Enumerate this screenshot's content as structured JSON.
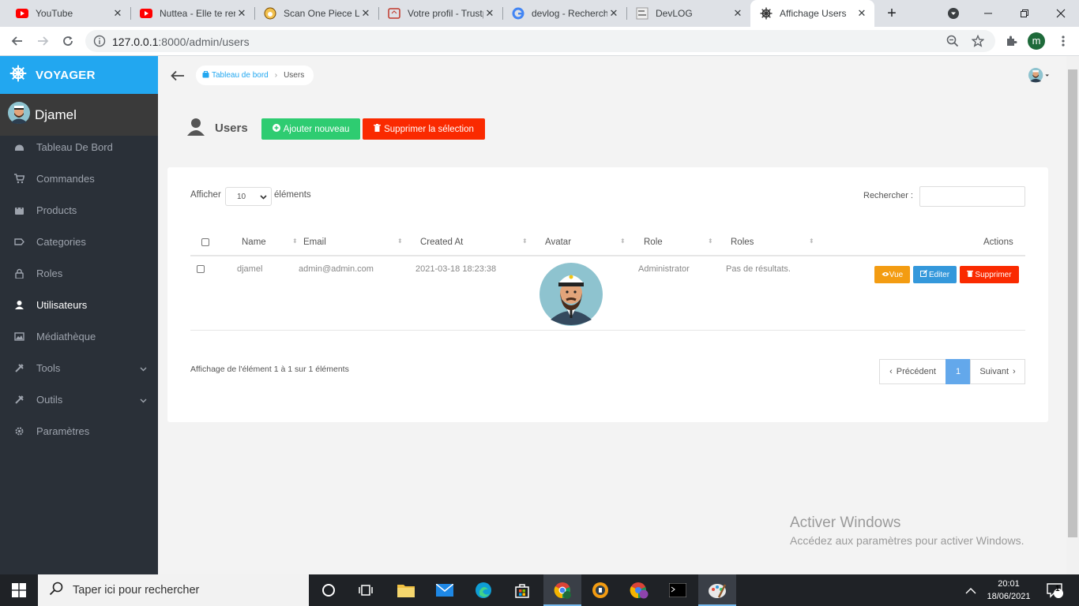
{
  "browser": {
    "tabs": [
      {
        "title": "YouTube",
        "icon": "youtube-icon"
      },
      {
        "title": "Nuttea - Elle te rend dingue",
        "icon": "youtube-icon"
      },
      {
        "title": "Scan One Piece Lecture",
        "icon": "one-piece-icon"
      },
      {
        "title": "Votre profil - Trustpilot",
        "icon": "trust-icon"
      },
      {
        "title": "devlog - Recherche Google",
        "icon": "google-icon"
      },
      {
        "title": "DevLOG",
        "icon": "devlog-icon"
      },
      {
        "title": "Affichage Users",
        "icon": "helm-icon",
        "active": true
      }
    ],
    "new_tab": "+",
    "url_host": "127.0.0.1",
    "url_path": ":8000/admin/users",
    "profile_letter": "m"
  },
  "sidebar": {
    "brand": "VOYAGER",
    "user_name": "Djamel",
    "items": [
      {
        "label": "Tableau De Bord",
        "icon": "dashboard-icon"
      },
      {
        "label": "Commandes",
        "icon": "cart-icon"
      },
      {
        "label": "Products",
        "icon": "bag-icon"
      },
      {
        "label": "Categories",
        "icon": "tag-icon"
      },
      {
        "label": "Roles",
        "icon": "lock-icon"
      },
      {
        "label": "Utilisateurs",
        "icon": "person-icon",
        "active": true
      },
      {
        "label": "Médiathèque",
        "icon": "images-icon"
      },
      {
        "label": "Tools",
        "icon": "tools-icon",
        "expandable": true
      },
      {
        "label": "Outils",
        "icon": "tools-icon",
        "expandable": true
      },
      {
        "label": "Paramètres",
        "icon": "gear-icon"
      }
    ]
  },
  "breadcrumb": {
    "home": "Tableau de bord",
    "current": "Users"
  },
  "page": {
    "title": "Users",
    "add_button": "Ajouter nouveau",
    "delete_selection_button": "Supprimer la sélection"
  },
  "table_controls": {
    "show_label": "Afficher",
    "page_size": "10",
    "entries_label": "éléments",
    "search_label": "Rechercher :"
  },
  "table": {
    "columns": [
      "Name",
      "Email",
      "Created At",
      "Avatar",
      "Role",
      "Roles",
      "Actions"
    ],
    "rows": [
      {
        "name": "djamel",
        "email": "admin@admin.com",
        "created_at": "2021-03-18 18:23:38",
        "role": "Administrator",
        "roles": "Pas de résultats.",
        "actions": {
          "view": "Vue",
          "edit": "Editer",
          "delete": "Supprimer"
        }
      }
    ]
  },
  "pagination": {
    "info": "Affichage de l'élément 1 à 1 sur 1 éléments",
    "prev": "Précédent",
    "current": "1",
    "next": "Suivant"
  },
  "watermark": {
    "title": "Activer Windows",
    "subtitle": "Accédez aux paramètres pour activer Windows."
  },
  "taskbar": {
    "search_placeholder": "Taper ici pour rechercher",
    "time": "20:01",
    "date": "18/06/2021",
    "notification_count": "1"
  },
  "colors": {
    "brand": "#22a7f0",
    "sidebar_bg": "#2a3038",
    "add_green": "#2ecc71",
    "delete_red": "#fa2a00",
    "view_orange": "#f39c12",
    "edit_blue": "#3498db",
    "page_active": "#63a8eb"
  }
}
